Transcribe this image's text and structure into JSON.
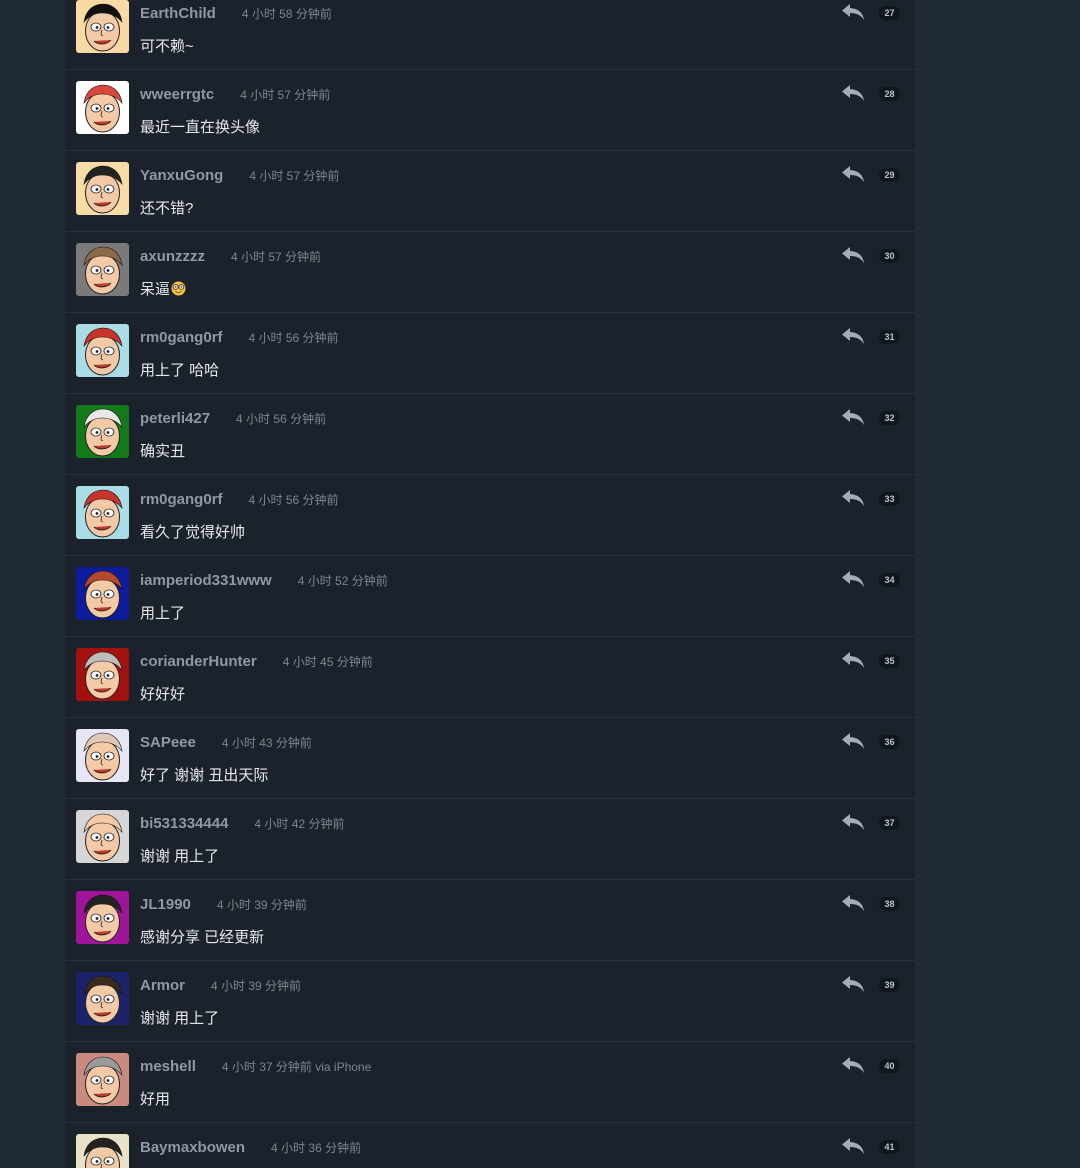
{
  "replies": [
    {
      "floor": "27",
      "username": "EarthChild",
      "time": "4 小时 58 分钟前",
      "text": "可不赖~",
      "avatar_bg": "#f9d9a4",
      "hair": "#111111"
    },
    {
      "floor": "28",
      "username": "wweerrgtc",
      "time": "4 小时 57 分钟前",
      "text": "最近一直在换头像",
      "avatar_bg": "#ffffff",
      "hair": "#d9483b"
    },
    {
      "floor": "29",
      "username": "YanxuGong",
      "time": "4 小时 57 分钟前",
      "text": "还不错?",
      "avatar_bg": "#f8dca6",
      "hair": "#222222"
    },
    {
      "floor": "30",
      "username": "axunzzzz",
      "time": "4 小时 57 分钟前",
      "text": "呆逼",
      "emoji": "nerd-face-emoji",
      "avatar_bg": "#7a7a7a",
      "hair": "#8a6a4a"
    },
    {
      "floor": "31",
      "username": "rm0gang0rf",
      "time": "4 小时 56 分钟前",
      "text": "用上了 哈哈",
      "avatar_bg": "#a9dce6",
      "hair": "#c8332b"
    },
    {
      "floor": "32",
      "username": "peterli427",
      "time": "4 小时 56 分钟前",
      "text": "确实丑",
      "avatar_bg": "#137a1a",
      "hair": "#e8e8e8"
    },
    {
      "floor": "33",
      "username": "rm0gang0rf",
      "time": "4 小时 56 分钟前",
      "text": "看久了觉得好帅",
      "avatar_bg": "#a9dce6",
      "hair": "#c8332b"
    },
    {
      "floor": "34",
      "username": "iamperiod331www",
      "time": "4 小时 52 分钟前",
      "text": "用上了",
      "avatar_bg": "#0d1c9a",
      "hair": "#b5492e"
    },
    {
      "floor": "35",
      "username": "corianderHunter",
      "time": "4 小时 45 分钟前",
      "text": "好好好",
      "avatar_bg": "#a3110e",
      "hair": "#bdbdbd"
    },
    {
      "floor": "36",
      "username": "SAPeee",
      "time": "4 小时 43 分钟前",
      "text": "好了 谢谢 丑出天际",
      "avatar_bg": "#e6e6f5",
      "hair": "#e0c8b8"
    },
    {
      "floor": "37",
      "username": "bi531334444",
      "time": "4 小时 42 分钟前",
      "text": "谢谢 用上了",
      "avatar_bg": "#d6d6d6",
      "hair": "#f3c9a8"
    },
    {
      "floor": "38",
      "username": "JL1990",
      "time": "4 小时 39 分钟前",
      "text": "感谢分享 已经更新",
      "avatar_bg": "#a0149a",
      "hair": "#222222"
    },
    {
      "floor": "39",
      "username": "Armor",
      "time": "4 小时 39 分钟前",
      "text": "谢谢 用上了",
      "avatar_bg": "#1c236b",
      "hair": "#3a2a20"
    },
    {
      "floor": "40",
      "username": "meshell",
      "time": "4 小时 37 分钟前 via iPhone",
      "text": "好用",
      "avatar_bg": "#c98a80",
      "hair": "#9a9a9a"
    },
    {
      "floor": "41",
      "username": "Baymaxbowen",
      "time": "4 小时 36 分钟前",
      "text": "",
      "avatar_bg": "#e9e2c8",
      "hair": "#222222"
    }
  ],
  "colors": {
    "page_bg": "#1f2a36",
    "thread_bg": "#1b222b",
    "username": "#8f98a3",
    "text": "#e6e9ec",
    "floor_badge_bg": "#10161c"
  },
  "icons": {
    "reply": "reply-arrow-icon",
    "avatar": "cartoon-face-avatar"
  }
}
